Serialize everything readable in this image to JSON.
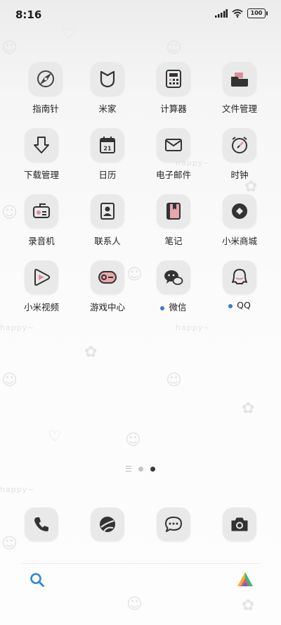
{
  "status_bar": {
    "time": "8:16",
    "battery": "100"
  },
  "wallpaper": {
    "text_1": "happy~",
    "text_2": "happy~",
    "text_3": "happy~",
    "text_4": "happy~"
  },
  "apps": [
    {
      "label": "指南针",
      "icon": "compass-icon"
    },
    {
      "label": "米家",
      "icon": "mijia-icon"
    },
    {
      "label": "计算器",
      "icon": "calculator-icon"
    },
    {
      "label": "文件管理",
      "icon": "folder-icon"
    },
    {
      "label": "下载管理",
      "icon": "download-icon"
    },
    {
      "label": "日历",
      "icon": "calendar-icon",
      "date": "21"
    },
    {
      "label": "电子邮件",
      "icon": "mail-icon"
    },
    {
      "label": "时钟",
      "icon": "clock-icon"
    },
    {
      "label": "录音机",
      "icon": "recorder-icon"
    },
    {
      "label": "联系人",
      "icon": "contacts-icon"
    },
    {
      "label": "笔记",
      "icon": "notes-icon"
    },
    {
      "label": "小米商城",
      "icon": "mi-store-icon"
    },
    {
      "label": "小米视频",
      "icon": "mi-video-icon"
    },
    {
      "label": "游戏中心",
      "icon": "game-center-icon"
    },
    {
      "label": "微信",
      "icon": "wechat-icon",
      "new": true
    },
    {
      "label": "QQ",
      "icon": "qq-icon",
      "new": true
    }
  ],
  "pager": {
    "pages": 2,
    "active": 2
  },
  "dock": [
    {
      "icon": "phone-icon"
    },
    {
      "icon": "browser-icon"
    },
    {
      "icon": "messages-icon"
    },
    {
      "icon": "camera-icon"
    }
  ],
  "colors": {
    "accent_blue": "#3a7bd5",
    "tile_bg": "#e9e9e9",
    "notes_pink": "#e7a7ad"
  }
}
